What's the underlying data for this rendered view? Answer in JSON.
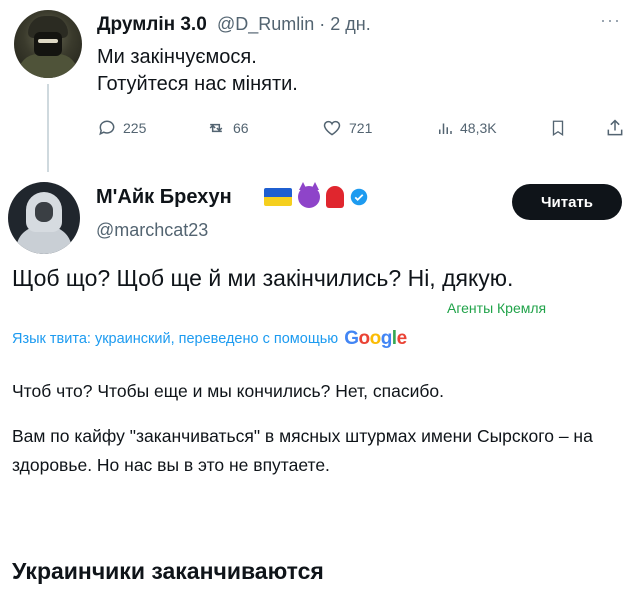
{
  "tweet_parent": {
    "author_name": "Друмлін 3.0",
    "handle_and_time": "@D_Rumlin · 2 дн.",
    "more_label": "···",
    "text_line_1": "Ми закінчуємося.",
    "text_line_2": "Готуйтеся нас міняти.",
    "actions": {
      "replies": "225",
      "reposts": "66",
      "likes": "721",
      "views": "48,3K"
    }
  },
  "tweet_reply": {
    "author_name": "М'Айк Брехун",
    "handle": "@marchcat23",
    "follow_button": "Читать",
    "text": "Щоб що? Щоб ще й ми закінчились? Ні, дякую.",
    "watermark": "Агенты Кремля",
    "translation_note": "Язык твита: украинский, переведено с помощью",
    "translation_provider": [
      "G",
      "o",
      "o",
      "g",
      "l",
      "e"
    ],
    "translation_line_1": "Чтоб что? Чтобы еще и мы кончились? Нет, спасибо.",
    "translation_paragraph": "Вам по кайфу \"заканчиваться\" в мясных штурмах имени Сырского – на здоровье. Но нас вы в это не впутаете."
  },
  "caption": "Украинчики заканчиваются",
  "colors": {
    "link_blue": "#1d9bf0",
    "watermark_green": "#21a34a",
    "secondary_text": "#536471",
    "button_bg": "#0f1419"
  }
}
